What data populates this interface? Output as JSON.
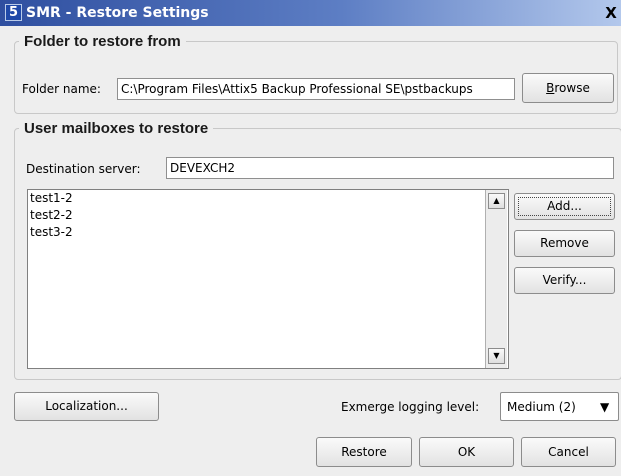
{
  "window": {
    "title": "SMR - Restore Settings",
    "app_icon_glyph": "5",
    "close_glyph": "X"
  },
  "restore_from": {
    "legend": "Folder to restore from",
    "folder_label": "Folder name:",
    "folder_value": "C:\\Program Files\\Attix5 Backup Professional SE\\pstbackups",
    "browse": {
      "pre": "",
      "mnemonic": "B",
      "post": "rowse"
    }
  },
  "mailboxes": {
    "legend": "User mailboxes to restore",
    "server_label": "Destination server:",
    "server_value": "DEVEXCH2",
    "items": [
      "test1-2",
      "test2-2",
      "test3-2"
    ],
    "add_label": "Add...",
    "remove_label": "Remove",
    "verify_label": "Verify..."
  },
  "bottom": {
    "localization_label": "Localization...",
    "logging_label": "Exmerge logging level:",
    "logging_value": "Medium (2)",
    "restore_label": "Restore",
    "ok_label": "OK",
    "cancel_label": "Cancel"
  },
  "icons": {
    "scroll_up": "▲",
    "scroll_down": "▼",
    "combo_arrow": "▼"
  },
  "colors": {
    "titlebar": "#2f4fa0",
    "background": "#eeeeee"
  }
}
